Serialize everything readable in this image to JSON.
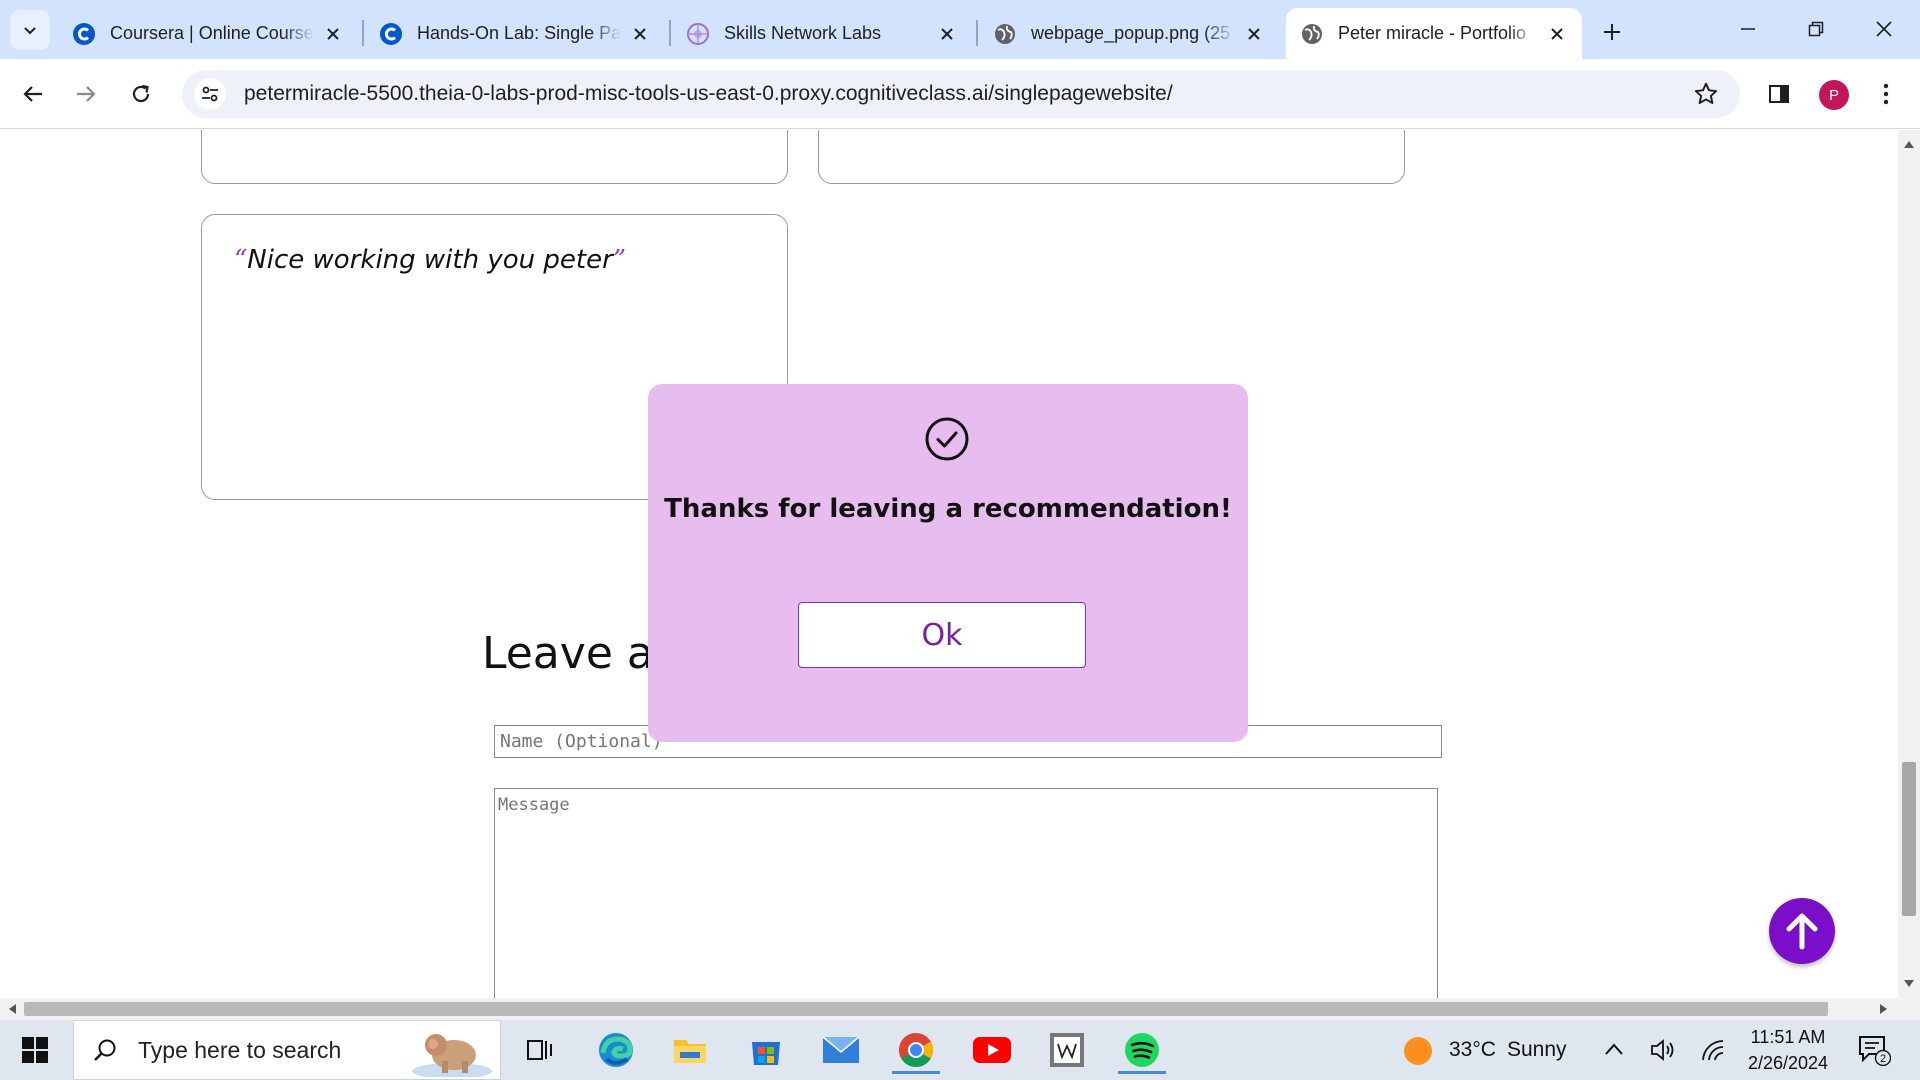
{
  "browser": {
    "tabs": [
      {
        "title": "Coursera | Online Courses",
        "favicon": "coursera-icon",
        "active": false
      },
      {
        "title": "Hands-On Lab: Single Page",
        "favicon": "coursera-icon",
        "active": false
      },
      {
        "title": "Skills Network Labs",
        "favicon": "skills-network-icon",
        "active": false
      },
      {
        "title": "webpage_popup.png (25",
        "favicon": "globe-icon",
        "active": false
      },
      {
        "title": "Peter miracle - Portfolio",
        "favicon": "globe-icon",
        "active": true
      }
    ],
    "url": "petermiracle-5500.theia-0-labs-prod-misc-tools-us-east-0.proxy.cognitiveclass.ai/singlepagewebsite/",
    "profile_initial": "P",
    "colors": {
      "tabstrip": "#d3e3fd",
      "profile": "#c2185b"
    }
  },
  "page": {
    "recommendation_quote": "Nice working with you peter",
    "quote_open": "“",
    "quote_close": "”",
    "section_heading": "Leave a",
    "name_placeholder": "Name (Optional)",
    "message_placeholder": "Message",
    "popup": {
      "icon": "check-circle-icon",
      "message": "Thanks for leaving a recommendation!",
      "ok_label": "Ok",
      "background": "#e7bcee"
    },
    "back_to_top": {
      "icon": "arrow-up-icon",
      "color": "#7a0ec9"
    }
  },
  "taskbar": {
    "search_placeholder": "Type here to search",
    "apps": [
      "task-view-icon",
      "edge-icon",
      "file-explorer-icon",
      "microsoft-store-icon",
      "mail-icon",
      "chrome-icon",
      "youtube-icon",
      "wikipedia-icon",
      "spotify-icon"
    ],
    "weather": {
      "temp": "33°C",
      "condition": "Sunny"
    },
    "time": "11:51 AM",
    "date": "2/26/2024",
    "notification_count": "2"
  }
}
